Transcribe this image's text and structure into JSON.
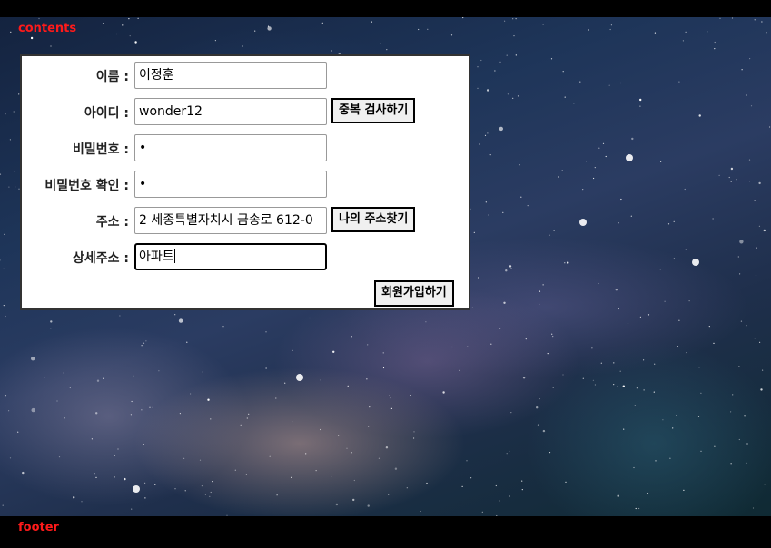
{
  "page": {
    "contents_label": "contents",
    "footer_label": "footer"
  },
  "form": {
    "name": {
      "label": "이름 :",
      "value": "이정훈"
    },
    "userid": {
      "label": "아이디 :",
      "value": "wonder12",
      "check_button": "중복 검사하기"
    },
    "password": {
      "label": "비밀번호 :",
      "value": "•"
    },
    "password_confirm": {
      "label": "비밀번호 확인 :",
      "value": "•"
    },
    "address": {
      "label": "주소 :",
      "value": "2  세종특별자치시  금송로 612-0",
      "find_button": "나의 주소찾기"
    },
    "address_detail": {
      "label": "상세주소 :",
      "value": "아파트"
    },
    "submit_button": "회원가입하기"
  },
  "colors": {
    "label_accent": "#ff1a1a",
    "bar_background": "#000000"
  }
}
